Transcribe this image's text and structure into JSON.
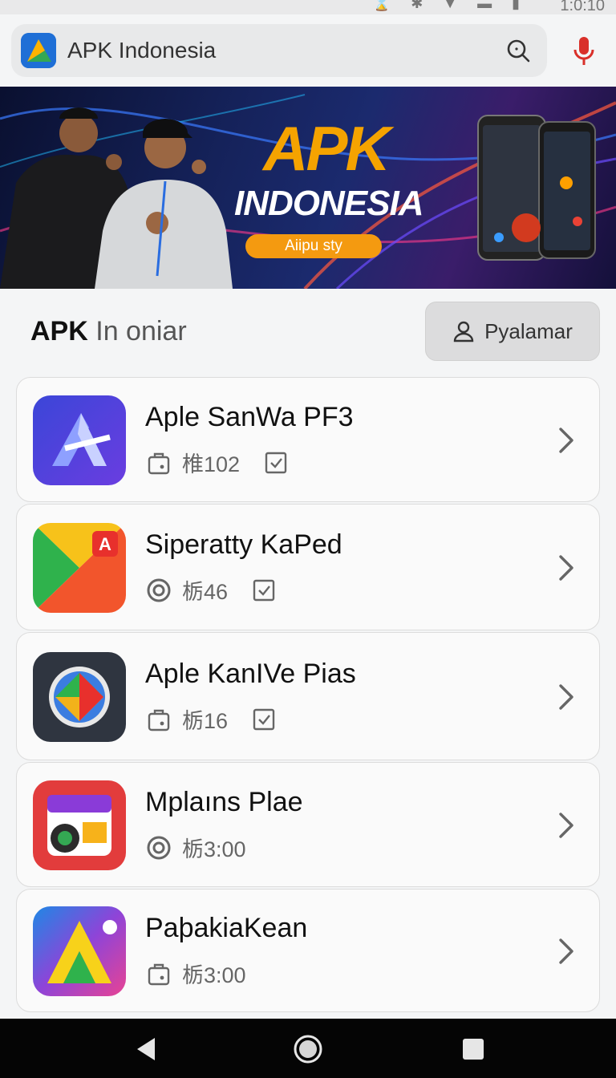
{
  "status_bar": {
    "time": "1:0:10",
    "icons": "⌛ ✱ ▼ ▬ ▮"
  },
  "search": {
    "text": "APK Indonesia"
  },
  "banner": {
    "title": "APK",
    "subtitle": "INDONESIA",
    "pill": "Aiipu sty"
  },
  "section": {
    "title_bold": "APK",
    "title_rest": " In oniar",
    "filter_label": "Pyalamar"
  },
  "apps": [
    {
      "name": "Aple SanWa PF3",
      "meta": "椎102",
      "meta_icon": "lock-bag-icon",
      "has_check": true
    },
    {
      "name": "Siperatty  KaPed",
      "meta": "栃46",
      "meta_icon": "target-icon",
      "has_check": true
    },
    {
      "name": "Aple KanIVe Pias",
      "meta": "栃16",
      "meta_icon": "lock-bag-icon",
      "has_check": true
    },
    {
      "name": "Mplaıns Plae",
      "meta": "栃3:00",
      "meta_icon": "target-icon",
      "has_check": false
    },
    {
      "name": "PaþakiaKean",
      "meta": "栃3:00",
      "meta_icon": "lock-bag-icon",
      "has_check": false
    }
  ],
  "colors": {
    "accent": "#f49a10",
    "mic": "#d9302a",
    "nav": "#050505"
  }
}
